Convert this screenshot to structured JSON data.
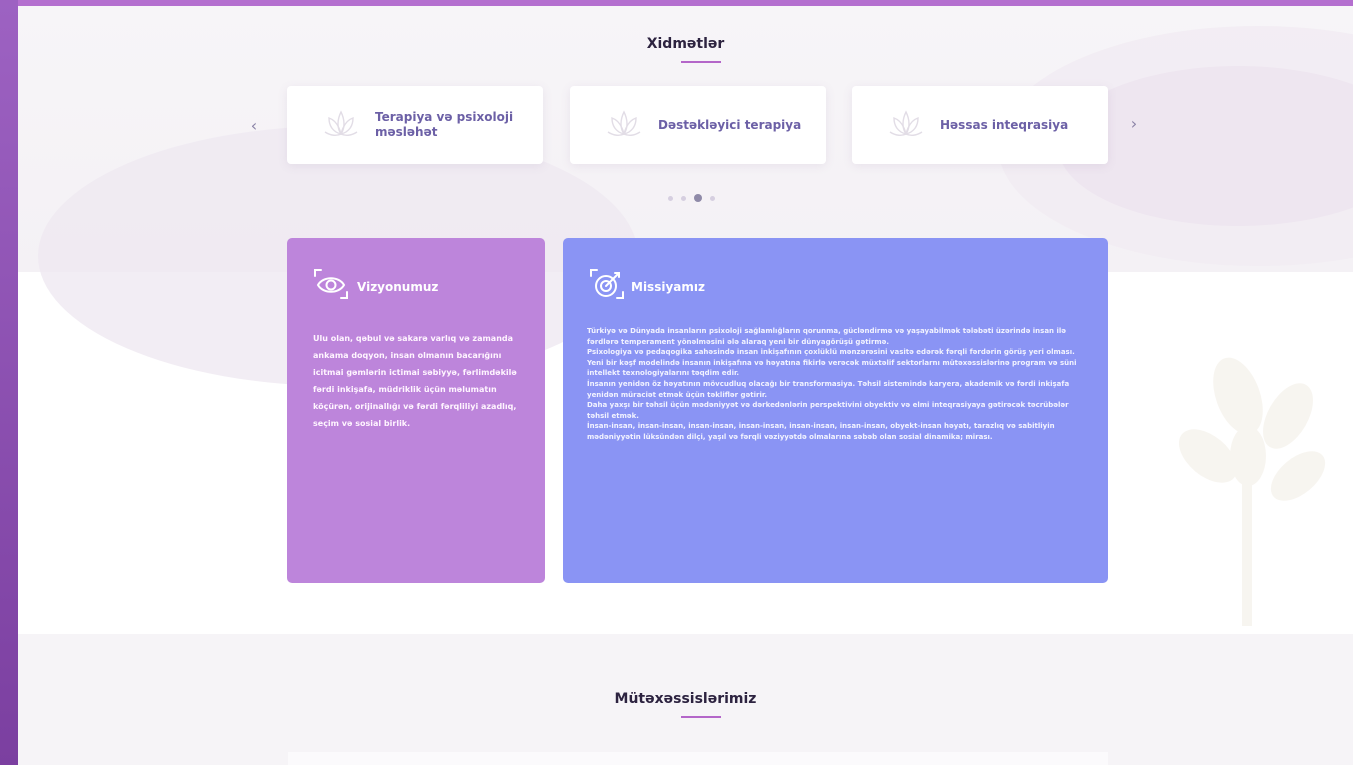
{
  "services": {
    "title": "Xidmətlər",
    "prev_arrow": "‹",
    "next_arrow": "›",
    "cards": [
      {
        "label": "Terapiya və psixoloji məsləhət",
        "icon": "lotus-icon"
      },
      {
        "label": "Dəstəkləyici terapiya",
        "icon": "lotus-icon"
      },
      {
        "label": "Həssas inteqrasiya",
        "icon": "lotus-icon"
      }
    ],
    "carousel_dots": 4,
    "active_dot": 2
  },
  "vision": {
    "title": "Vizyonumuz",
    "icon": "eye-icon",
    "text": "Ulu olan, qəbul və sakarə varlıq və zamanda ankama doqyon, insan olmanın bacarığını icitmai gəmlərin ictimai səbiyyə, fərlimdəkilə fərdi inkişafa, müdriklik üçün məlumatın köçürən, orijinallığı və fərdi fərqliliyi azadlıq, seçim və sosial birlik."
  },
  "mission": {
    "title": "Missiyamız",
    "icon": "target-icon",
    "paragraphs": [
      "Türkiyə və Dünyada insanların psixoloji sağlamlığların qorunma, gücləndirmə və yaşayabilmək tələbəti üzərində insan ilə fərdlərə temperament yönəlməsini ələ alaraq yeni bir dünyagörüşü gətirmə.",
      "Psixologiya və pedaqogika sahəsində insan inkişafının çoxlüklü mənzərəsini vasitə edərək fərqli fərdərin görüş yeri olması.",
      "Yeni bir kəşf modelində insanın inkişafına və həyatına fikirlə verəcək müxtəlif sektorlarnı mütəxəssislərinə program və süni intellekt texnologiyalarını təqdim edir.",
      "İnsanın yenidən öz həyatının mövcudluq olacağı bir transformasiya. Təhsil sistemində karyera, akademik və fərdi inkişafa yenidən müraciət etmək üçün təkliflər gətirir.",
      "Daha yaxşı bir təhsil üçün mədəniyyət və dərkedənlərin perspektivini obyektiv və elmi inteqrasiyaya gətirəcək təcrübələr təhsil etmək.",
      "İnsan-insan, insan-insan, insan-insan, insan-insan, insan-insan, insan-insan, obyekt-insan həyatı, tarazlıq və sabitliyin mədəniyyətin lüksündən dilçi, yaşıl və fərqli vəziyyətdə olmalarına səbəb olan sosial dinamika; mirası."
    ]
  },
  "experts": {
    "title": "Mütəxəssislərimiz"
  },
  "colors": {
    "frame": "#8a4fb0",
    "vision_card": "#bd85db",
    "mission_card": "#8a94f4",
    "accent": "#b466c9"
  }
}
